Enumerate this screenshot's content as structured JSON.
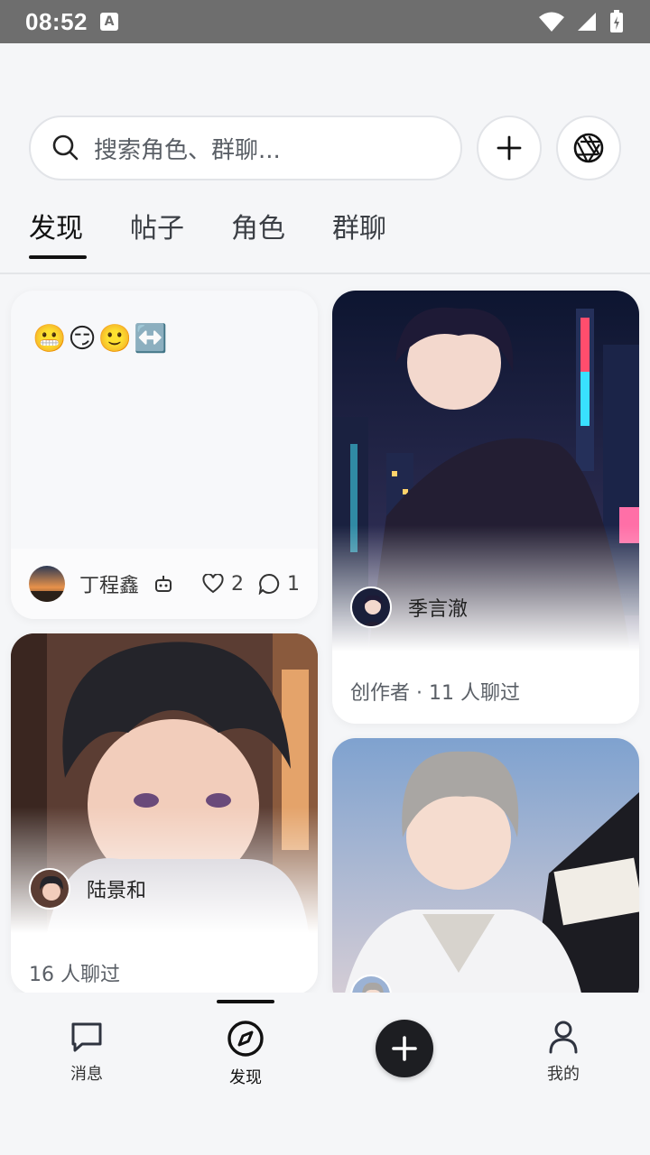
{
  "status_bar": {
    "time": "08:52",
    "a_label": "A"
  },
  "search": {
    "placeholder": "搜索角色、群聊..."
  },
  "tabs": [
    {
      "label": "发现",
      "active": true
    },
    {
      "label": "帖子",
      "active": false
    },
    {
      "label": "角色",
      "active": false
    },
    {
      "label": "群聊",
      "active": false
    }
  ],
  "post_card": {
    "emojis": [
      "😬",
      "😏",
      "🙂",
      "↔️"
    ],
    "author": "丁程鑫",
    "likes": "2",
    "comments": "1"
  },
  "character_cards": [
    {
      "name": "季言澈",
      "meta": "创作者 · 11 人聊过"
    },
    {
      "name": "陆景和",
      "meta": "16 人聊过"
    },
    {
      "name": "",
      "meta": ""
    }
  ],
  "bottom_nav": [
    {
      "label": "消息",
      "icon": "chat-bubble-icon"
    },
    {
      "label": "发现",
      "icon": "compass-icon",
      "active": true
    },
    {
      "label": "",
      "icon": "plus-icon"
    },
    {
      "label": "我的",
      "icon": "user-icon"
    }
  ],
  "colors": {
    "accent": "#1d1e22",
    "background": "#f5f6f8",
    "status_bar": "#6e6e6e"
  }
}
